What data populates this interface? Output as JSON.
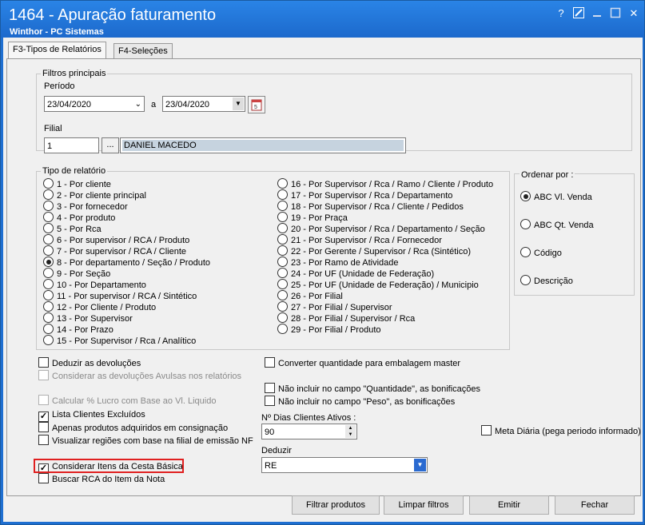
{
  "window": {
    "title": "1464 - Apuração faturamento",
    "subtitle": "Winthor - PC Sistemas",
    "controls": {
      "help": "?",
      "restore": "",
      "minimize": "",
      "maximize": "",
      "close": "✕"
    }
  },
  "tabs": [
    {
      "label": "F3-Tipos de Relatórios",
      "active": true
    },
    {
      "label": "F4-Seleções",
      "active": false
    }
  ],
  "filtros": {
    "group_label": "Filtros principais",
    "periodo_label": "Período",
    "data_inicio": "23/04/2020",
    "separator": "a",
    "data_fim": "23/04/2020",
    "filial_label": "Filial",
    "filial_codigo": "1",
    "filial_browse": "...",
    "filial_nome": "DANIEL MACEDO"
  },
  "tipo_relatorio": {
    "group_label": "Tipo de relatório",
    "selected_index": 7,
    "col1": [
      "1 - Por cliente",
      "2 - Por cliente principal",
      "3 - Por fornecedor",
      "4 - Por produto",
      "5 - Por Rca",
      "6 - Por supervisor / RCA / Produto",
      "7 - Por supervisor / RCA / Cliente",
      "8 - Por departamento / Seção / Produto",
      "9 - Por Seção",
      "10 - Por Departamento",
      "11 - Por supervisor / RCA / Sintético",
      "12 - Por Cliente / Produto",
      "13 - Por Supervisor",
      "14 - Por Prazo",
      "15 - Por Supervisor / Rca / Analítico"
    ],
    "col2": [
      "16 - Por Supervisor / Rca / Ramo /  Cliente / Produto",
      "17 - Por Supervisor / Rca / Departamento",
      "18 - Por Supervisor / Rca / Cliente / Pedidos",
      "19 - Por Praça",
      "20 - Por Supervisor / Rca / Departamento / Seção",
      "21 - Por Supervisor / Rca / Fornecedor",
      "22 - Por Gerente / Supervisor / Rca (Sintético)",
      "23 - Por Ramo de Atividade",
      "24 - Por UF (Unidade de Federação)",
      "25 - Por UF (Unidade de Federação) / Municipio",
      "26 - Por Filial",
      "27 - Por Filial / Supervisor",
      "28 - Por Filial / Supervisor / Rca",
      "29 - Por Filial / Produto"
    ]
  },
  "ordenar": {
    "group_label": "Ordenar por :",
    "options": [
      "ABC Vl. Venda",
      "ABC Qt. Venda",
      "Código",
      "Descrição"
    ],
    "selected_index": 0
  },
  "checks_left": [
    {
      "label": "Deduzir as devoluções",
      "checked": false,
      "disabled": false
    },
    {
      "label": "Considerar as devoluções Avulsas nos relatórios",
      "checked": false,
      "disabled": true
    },
    {
      "label": "Calcular % Lucro com Base ao Vl. Liquido",
      "checked": false,
      "disabled": true
    },
    {
      "label": "Lista Clientes Excluídos",
      "checked": true,
      "disabled": false
    },
    {
      "label": "Apenas produtos adquiridos em consignação",
      "checked": false,
      "disabled": false
    },
    {
      "label": "Visualizar regiões com base na filial de emissão NF",
      "checked": false,
      "disabled": false
    },
    {
      "label": "Considerar Itens da Cesta Básica",
      "checked": true,
      "disabled": false
    },
    {
      "label": "Buscar RCA do Item da Nota",
      "checked": false,
      "disabled": false
    }
  ],
  "checks_right": [
    {
      "label": "Converter quantidade para embalagem master",
      "checked": false
    },
    {
      "label": "Não incluir no campo \"Quantidade\", as bonificações",
      "checked": false
    },
    {
      "label": "Não incluir no campo \"Peso\", as bonificações",
      "checked": false
    }
  ],
  "dias_clientes": {
    "label": "Nº Dias Clientes Ativos :",
    "value": "90"
  },
  "meta_diaria": {
    "label": "Meta Diária (pega periodo informado)",
    "checked": false
  },
  "deduzir": {
    "label": "Deduzir",
    "value": "RE"
  },
  "buttons": {
    "filtrar": "Filtrar produtos",
    "limpar": "Limpar filtros",
    "emitir": "Emitir",
    "fechar": "Fechar"
  },
  "colors": {
    "title_bar": "#1f6fd1",
    "highlight": "#e02020",
    "selection": "#c6d3df"
  }
}
